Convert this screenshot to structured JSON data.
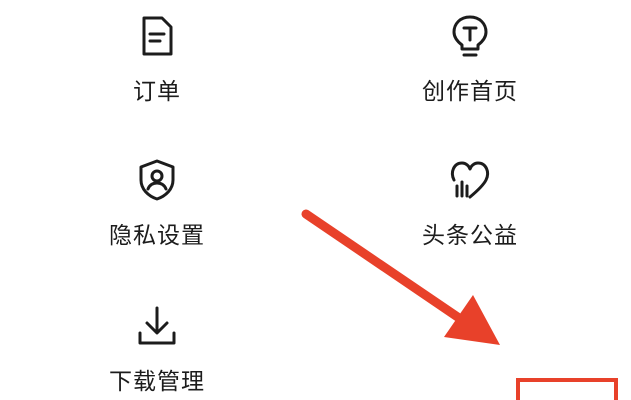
{
  "menu": {
    "items": [
      {
        "label": "订单",
        "icon": "document-icon"
      },
      {
        "label": "创作首页",
        "icon": "lightbulb-icon"
      },
      {
        "label": "隐私设置",
        "icon": "shield-user-icon"
      },
      {
        "label": "头条公益",
        "icon": "heart-chart-icon"
      },
      {
        "label": "下载管理",
        "icon": "download-icon"
      }
    ]
  },
  "annotation": {
    "arrow_color": "#e8412a",
    "box_color": "#e8412a"
  },
  "colors": {
    "text": "#1c1c1c",
    "icon": "#1c1c1c",
    "background": "#ffffff"
  }
}
